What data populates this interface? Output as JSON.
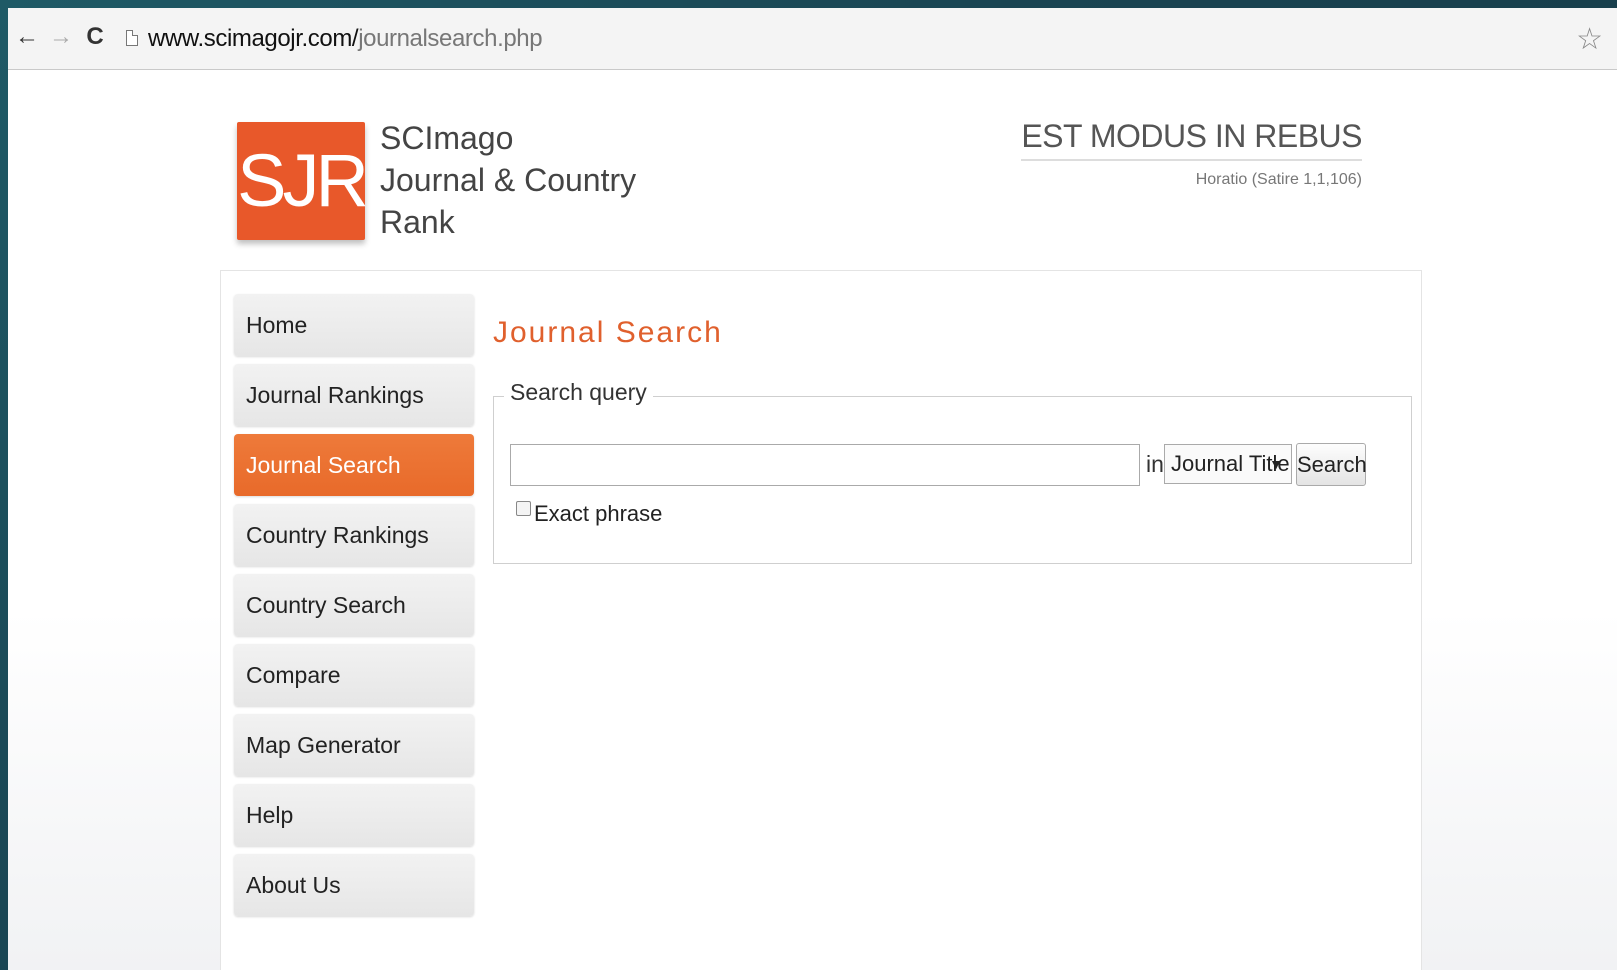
{
  "browser": {
    "back_icon": "←",
    "forward_icon": "→",
    "reload_icon": "C",
    "url_domain": "www.scimagojr.com/",
    "url_path": "journalsearch.php",
    "star_icon": "☆"
  },
  "header": {
    "logo_text": "SJR",
    "site_name_line1": "SCImago",
    "site_name_line2": "Journal & Country",
    "site_name_line3": "Rank",
    "motto": "EST MODUS IN REBUS",
    "motto_source": "Horatio (Satire 1,1,106)"
  },
  "sidebar": {
    "items": [
      {
        "label": "Home"
      },
      {
        "label": "Journal Rankings"
      },
      {
        "label": "Journal Search"
      },
      {
        "label": "Country Rankings"
      },
      {
        "label": "Country Search"
      },
      {
        "label": "Compare"
      },
      {
        "label": "Map Generator"
      },
      {
        "label": "Help"
      },
      {
        "label": "About Us"
      }
    ],
    "active_index": 2
  },
  "main": {
    "title": "Journal Search",
    "fieldset_legend": "Search query",
    "search_value": "",
    "in_label": "in",
    "select_value": "Journal Title",
    "search_button": "Search",
    "exact_phrase_label": "Exact phrase"
  },
  "colors": {
    "accent": "#e8582a",
    "active_menu": "#e86a2a"
  }
}
